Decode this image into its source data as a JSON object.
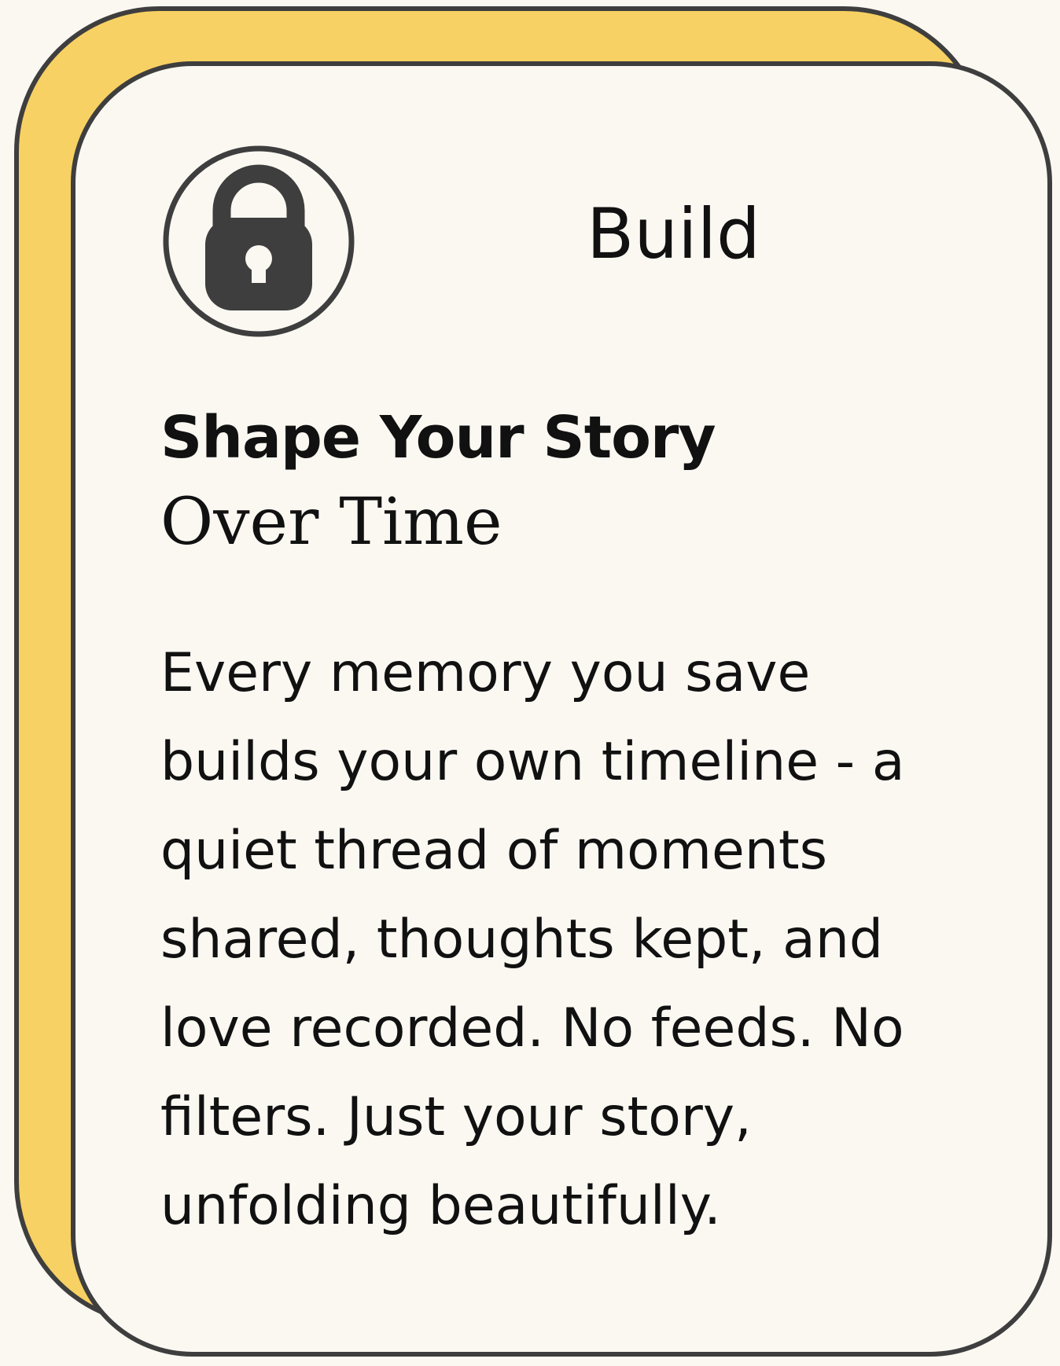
{
  "card": {
    "icon": "lock-icon",
    "category": "Build",
    "title": "Shape Your Story",
    "subtitle": "Over Time",
    "body_lines": [
      "Every memory you save",
      "builds your own timeline - a",
      "quiet thread of moments",
      "shared, thoughts kept, and",
      "love recorded. No feeds. No",
      "filters. Just your story,",
      "unfolding beautifully."
    ]
  },
  "colors": {
    "back_card": "#f7d163",
    "front_card": "#fbf8f2",
    "outline": "#3e3e3e",
    "text": "#111111"
  }
}
